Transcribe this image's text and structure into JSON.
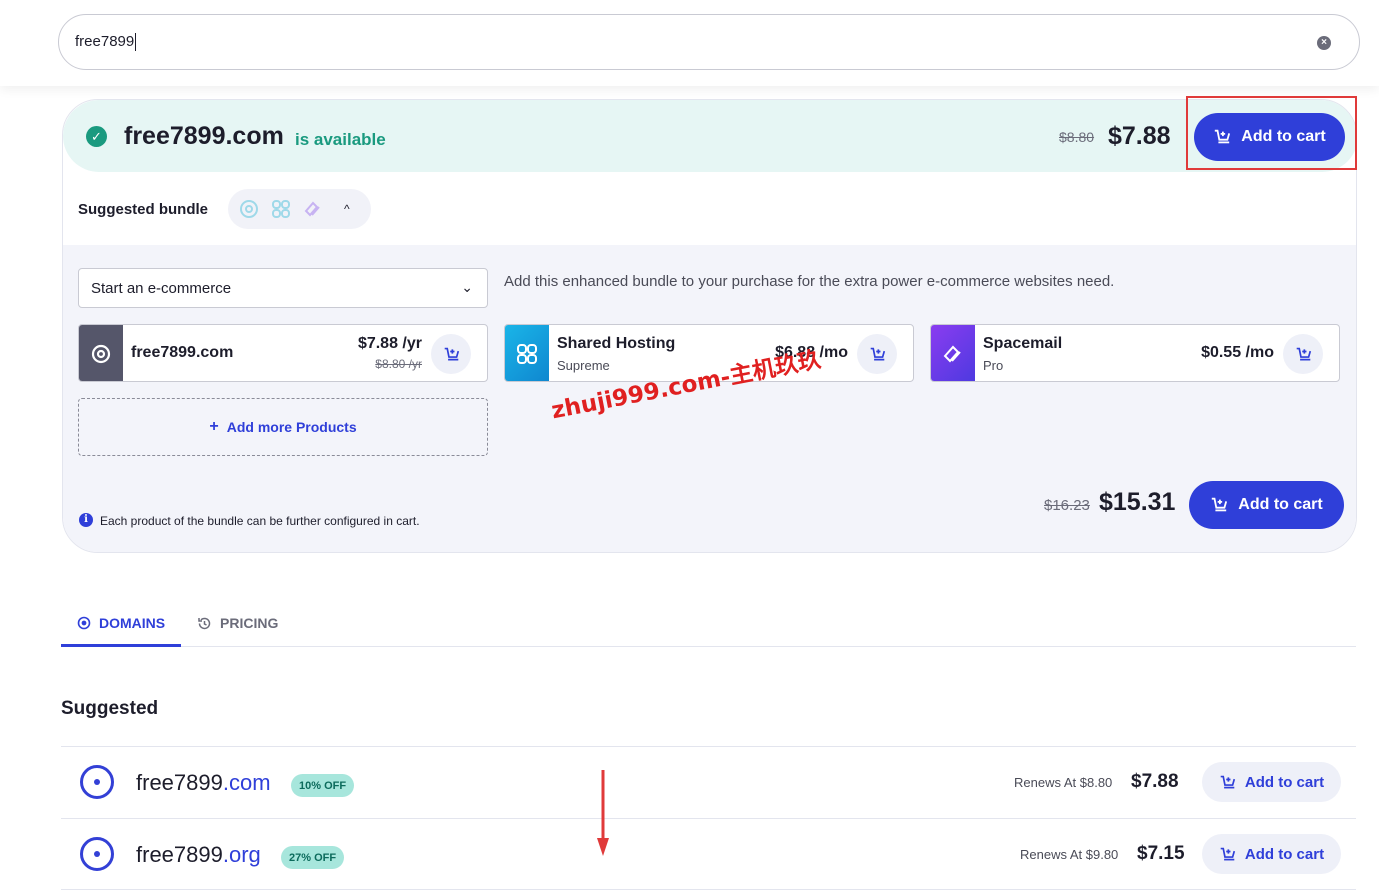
{
  "search": {
    "value": "free7899"
  },
  "availability": {
    "domain": "free7899.com",
    "status": "is available",
    "old_price": "$8.80",
    "price": "$7.88",
    "add_label": "Add to cart"
  },
  "bundle": {
    "heading": "Suggested bundle",
    "select_value": "Start an e-commerce",
    "description": "Add this enhanced bundle to your purchase for the extra power e-commerce websites need.",
    "products": [
      {
        "name": "free7899.com",
        "price": "$7.88 /yr",
        "old_price": "$8.80 /yr",
        "icon": "domain-icon",
        "color": "#55566a"
      },
      {
        "name": "Shared Hosting",
        "sub": "Supreme",
        "price": "$6.88 /mo",
        "icon": "hosting-icon",
        "color": "#1a9ee0"
      },
      {
        "name": "Spacemail",
        "sub": "Pro",
        "price": "$0.55 /mo",
        "icon": "spacemail-icon",
        "color": "#6a3cf0"
      }
    ],
    "add_more_label": "Add more Products",
    "info": "Each product of the bundle can be further configured in cart.",
    "old_total": "$16.23",
    "total": "$15.31",
    "add_label": "Add to cart"
  },
  "watermark": "zhuji999.com-主机玖玖",
  "tabs": [
    {
      "label": "DOMAINS",
      "active": true
    },
    {
      "label": "PRICING",
      "active": false
    }
  ],
  "suggested": {
    "title": "Suggested",
    "rows": [
      {
        "sld": "free7899",
        "tld": ".com",
        "badge": "10% OFF",
        "renew": "Renews At $8.80",
        "price": "$7.88",
        "add_label": "Add to cart"
      },
      {
        "sld": "free7899",
        "tld": ".org",
        "badge": "27% OFF",
        "renew": "Renews At $9.80",
        "price": "$7.15",
        "add_label": "Add to cart"
      }
    ]
  },
  "colors": {
    "accent": "#2f3fd9",
    "success": "#1a9a7f",
    "highlight": "#e03a3a"
  }
}
